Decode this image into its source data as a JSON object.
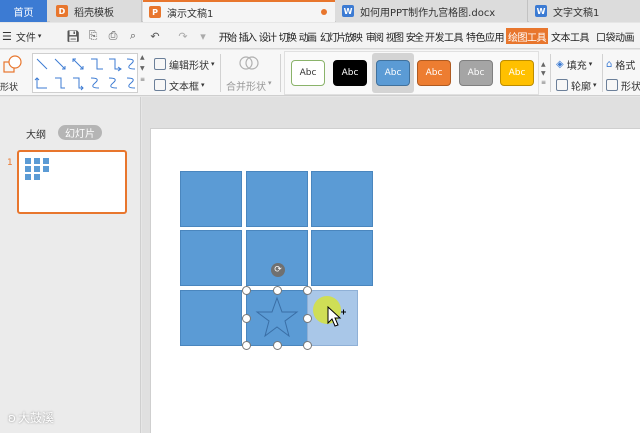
{
  "tabs": [
    {
      "label": "首页",
      "icon": "none"
    },
    {
      "label": "稻壳模板",
      "icon": "docer-icon"
    },
    {
      "label": "演示文稿1",
      "icon": "ppt-icon",
      "active": true,
      "unsaved": true
    },
    {
      "label": "如何用PPT制作九宫格图.docx",
      "icon": "word-icon"
    },
    {
      "label": "文字文稿1",
      "icon": "word-icon"
    }
  ],
  "menu": {
    "file_label": "文件",
    "ribbon_tabs": [
      "开始",
      "插入",
      "设计",
      "切换",
      "动画",
      "幻灯片放映",
      "审阅",
      "视图",
      "安全",
      "开发工具",
      "特色应用",
      "绘图工具",
      "文本工具",
      "口袋动画"
    ],
    "active_ribbon_tab": "绘图工具"
  },
  "ribbon": {
    "shape_label": "形状",
    "edit_shape": "编辑形状",
    "text_box": "文本框",
    "merge_shape": "合并形状",
    "styles": [
      {
        "label": "Abc",
        "bg": "#ffffff",
        "fg": "#333333",
        "border": "#8ab36a"
      },
      {
        "label": "Abc",
        "bg": "#000000",
        "fg": "#ffffff",
        "border": "#000000"
      },
      {
        "label": "Abc",
        "bg": "#5b9bd5",
        "fg": "#ffffff",
        "border": "#41719c"
      },
      {
        "label": "Abc",
        "bg": "#ed7d31",
        "fg": "#ffffff",
        "border": "#ae5a21"
      },
      {
        "label": "Abc",
        "bg": "#a5a5a5",
        "fg": "#ffffff",
        "border": "#7f7f7f"
      },
      {
        "label": "Abc",
        "bg": "#ffc000",
        "fg": "#ffffff",
        "border": "#bc8c00"
      }
    ],
    "fill": "填充",
    "outline": "轮廓",
    "format": "格式",
    "shape_effect": "形状"
  },
  "left_pane": {
    "outline_tab": "大纲",
    "slides_tab": "幻灯片",
    "slide_number": "1",
    "watermark": "大鼓溪"
  },
  "colors": {
    "accent": "#e8762d",
    "cell_blue": "#5b9bd5",
    "selected_ghost": "#a9c7e8"
  },
  "canvas": {
    "grid_rows": 3,
    "grid_cols": 3,
    "selected_cell": "row 3, col 2 (star shape inside)"
  }
}
